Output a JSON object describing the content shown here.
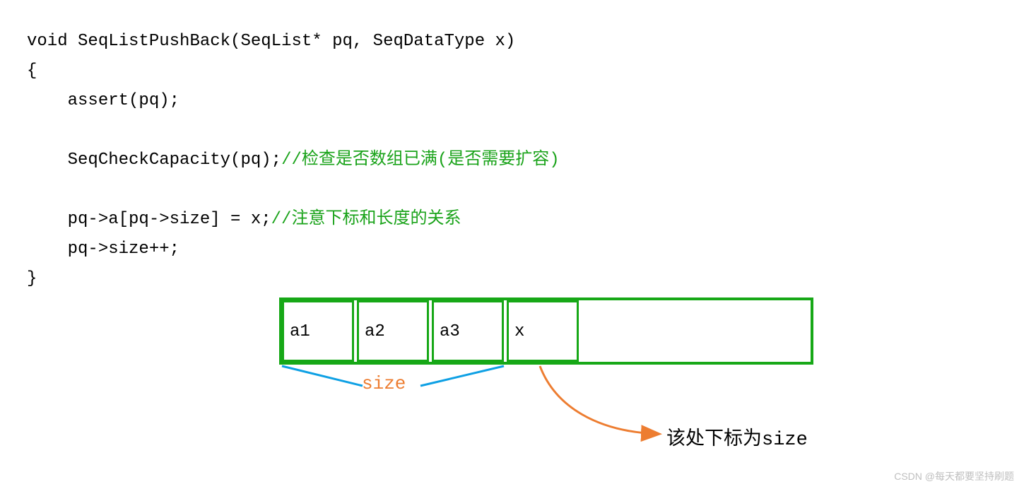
{
  "code": {
    "line1": "void SeqListPushBack(SeqList* pq, SeqDataType x)",
    "line2": "{",
    "line3": "    assert(pq);",
    "line4": "",
    "line5a": "    SeqCheckCapacity(pq);",
    "line5b": "//检查是否数组已满(是否需要扩容)",
    "line6": "",
    "line7a": "    pq->a[pq->size] = x;",
    "line7b": "//注意下标和长度的关系",
    "line8": "    pq->size++;",
    "line9": "}"
  },
  "cells": {
    "a1": "a1",
    "a2": "a2",
    "a3": "a3",
    "x": "x"
  },
  "labels": {
    "size": "size",
    "index_note": "该处下标为size"
  },
  "watermark": "CSDN @每天都要坚持刷题"
}
